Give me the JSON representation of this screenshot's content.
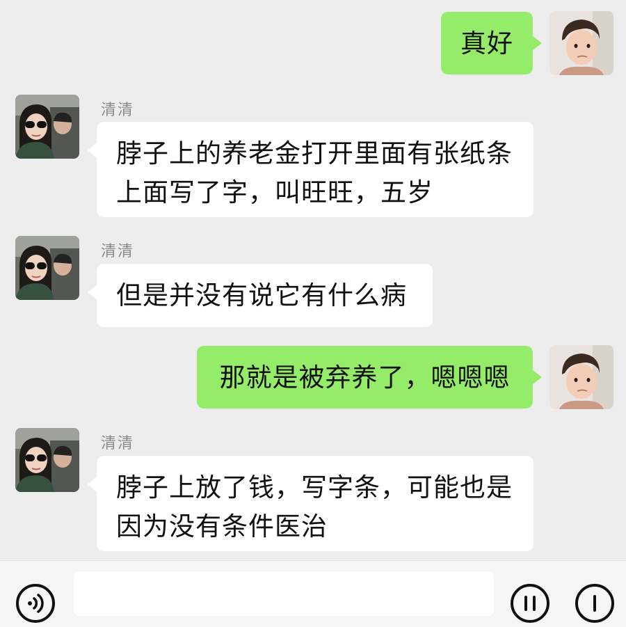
{
  "contact": {
    "name": "清清"
  },
  "messages": [
    {
      "sender": "me",
      "lines": [
        "真好"
      ]
    },
    {
      "sender": "contact",
      "name": "清清",
      "lines": [
        "脖子上的养老金打开里面有张纸条",
        "上面写了字，叫旺旺，五岁"
      ]
    },
    {
      "sender": "contact",
      "name": "清清",
      "lines": [
        "但是并没有说它有什么病"
      ]
    },
    {
      "sender": "me",
      "lines": [
        "那就是被弃养了，嗯嗯嗯"
      ]
    },
    {
      "sender": "contact",
      "name": "清清",
      "lines": [
        "脖子上放了钱，写字条，可能也是",
        "因为没有条件医治"
      ]
    }
  ],
  "input_bar": {
    "message_value": "",
    "icons": [
      "voice-icon",
      "emoji-icon",
      "more-icon"
    ]
  },
  "colors": {
    "background": "#ededed",
    "outgoing_bubble": "#95ec69",
    "incoming_bubble": "#ffffff",
    "sender_name": "#8a8a8a"
  }
}
